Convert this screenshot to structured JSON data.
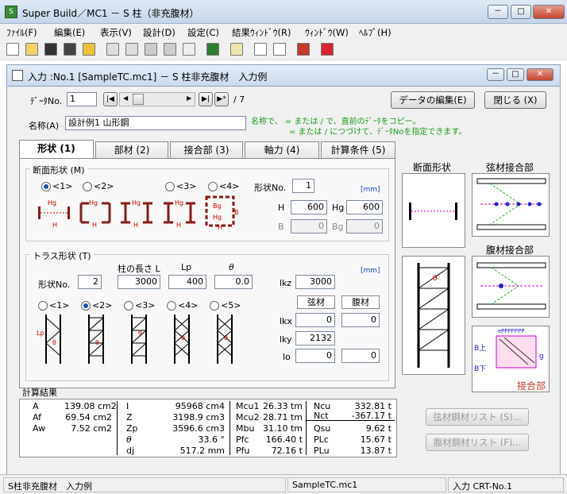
{
  "window": {
    "title": "Super Build／MC1 － S 柱（非充腹材）",
    "min": "－",
    "max": "□",
    "close": "✕"
  },
  "menu": [
    "ﾌｧｲﾙ(F)",
    "編集(E)",
    "表示(V)",
    "設計(D)",
    "設定(C)",
    "結果ｳｨﾝﾄﾞｳ(R)",
    "ｳｨﾝﾄﾞｳ(W)",
    "ﾍﾙﾌﾟ(H)"
  ],
  "toolbar_icons": [
    "new-icon",
    "open-icon",
    "save-icon",
    "save-as-icon",
    "folder-icon",
    "print-icon",
    "preview-icon",
    "print-setup-icon",
    "printer-icon",
    "settings-icon",
    "document-icon",
    "monitor-icon",
    "copy-icon",
    "window-tile-icon",
    "window-cascade-icon",
    "book-icon",
    "exit-icon"
  ],
  "inner": {
    "title": "入力 :No.1 [SampleTC.mc1] － S 柱非充腹材　入力例"
  },
  "record": {
    "label": "ﾃﾞｰﾀNo.",
    "value": "1",
    "total": "/ 7",
    "first": "|◀",
    "prev": "◀",
    "next": "▶",
    "last": "▶|",
    "new": "▶*",
    "edit_button": "データの編集(E)",
    "close_button": "閉じる (X)"
  },
  "name": {
    "label": "名称(A)",
    "value": "設計例1 山形鋼",
    "hint1": "名称で、 = または / で、直前のﾃﾞｰﾀをコピー。",
    "hint2": "= または / につづけて、ﾃﾞｰﾀNoを指定できます。"
  },
  "tabs": [
    "形状 (1)",
    "部材 (2)",
    "接合部 (3)",
    "軸力 (4)",
    "計算条件 (5)"
  ],
  "section": {
    "group_label": "断面形状 (M)",
    "options": [
      "<1>",
      "<2>",
      "<3>",
      "<4>"
    ],
    "selected": 0,
    "shape_no_label": "形状No.",
    "shape_no": "1",
    "unit": "[mm]",
    "H_label": "H",
    "H": "600",
    "Hg_label": "Hg",
    "Hg": "600",
    "B_label": "B",
    "B": "0",
    "Bg_label": "Bg",
    "Bg": "0",
    "glyph_labels": {
      "hg": "Hg",
      "h": "H",
      "bg": "Bg",
      "b": "B"
    }
  },
  "truss": {
    "group_label": "トラス形状 (T)",
    "shape_no_label": "形状No.",
    "shape_no": "2",
    "col_len_label": "柱の長さ L",
    "col_len": "3000",
    "lp_label": "Lp",
    "lp": "400",
    "theta_label": "θ",
    "theta": "0.0",
    "unit": "[mm]",
    "options": [
      "<1>",
      "<2>",
      "<3>",
      "<4>",
      "<5>"
    ],
    "selected": 1,
    "lkz_label": "lkz",
    "lkz": "3000",
    "col_chord": "弦材",
    "col_web": "腹材",
    "lkx_label": "lkx",
    "lkx_chord": "0",
    "lkx_web": "0",
    "lky_label": "lky",
    "lky_chord": "2132",
    "lo_label": "lo",
    "lo_chord": "0",
    "lo_web": "0",
    "glyph_labels": {
      "lp": "Lp",
      "theta": "θ"
    }
  },
  "side": {
    "section_label": "断面形状",
    "chord_label": "弦材接合部",
    "web_label": "腹材接合部",
    "joint_label": "接合部",
    "theta": "θ",
    "b_up": "B上",
    "b_down": "B下",
    "g": "g",
    "p_marks": "PPPPPPP",
    "e_mark": "e"
  },
  "results": {
    "label": "計算結果",
    "col1": [
      [
        "A",
        "139.08 cm2"
      ],
      [
        "Af",
        "69.54 cm2"
      ],
      [
        "Aw",
        "7.52 cm2"
      ]
    ],
    "col2": [
      [
        "I",
        "95968 cm4"
      ],
      [
        "Z",
        "3198.9 cm3"
      ],
      [
        "Zp",
        "3596.6 cm3"
      ],
      [
        "θ",
        "33.6 °"
      ],
      [
        "dj",
        "517.2 mm"
      ]
    ],
    "col3": [
      [
        "Mcu1",
        "26.33 tm"
      ],
      [
        "Mcu2",
        "28.71 tm"
      ],
      [
        "Mbu",
        "31.10 tm"
      ],
      [
        "Pfc",
        "166.40 t"
      ],
      [
        "Pfu",
        "72.16 t"
      ]
    ],
    "col4": [
      [
        "Ncu",
        "332.81 t"
      ],
      [
        "Nct",
        "-367.17 t"
      ],
      [
        "Qsu",
        "9.62 t"
      ],
      [
        "PLc",
        "15.67 t"
      ],
      [
        "PLu",
        "13.87 t"
      ]
    ]
  },
  "list_buttons": {
    "chord": "弦材鋼材リスト (S)...",
    "web": "腹材鋼材リスト (F)..."
  },
  "status": {
    "left": "S柱非充腹材　入力例",
    "file": "SampleTC.mc1",
    "right": "入力 CRT-No.1"
  }
}
